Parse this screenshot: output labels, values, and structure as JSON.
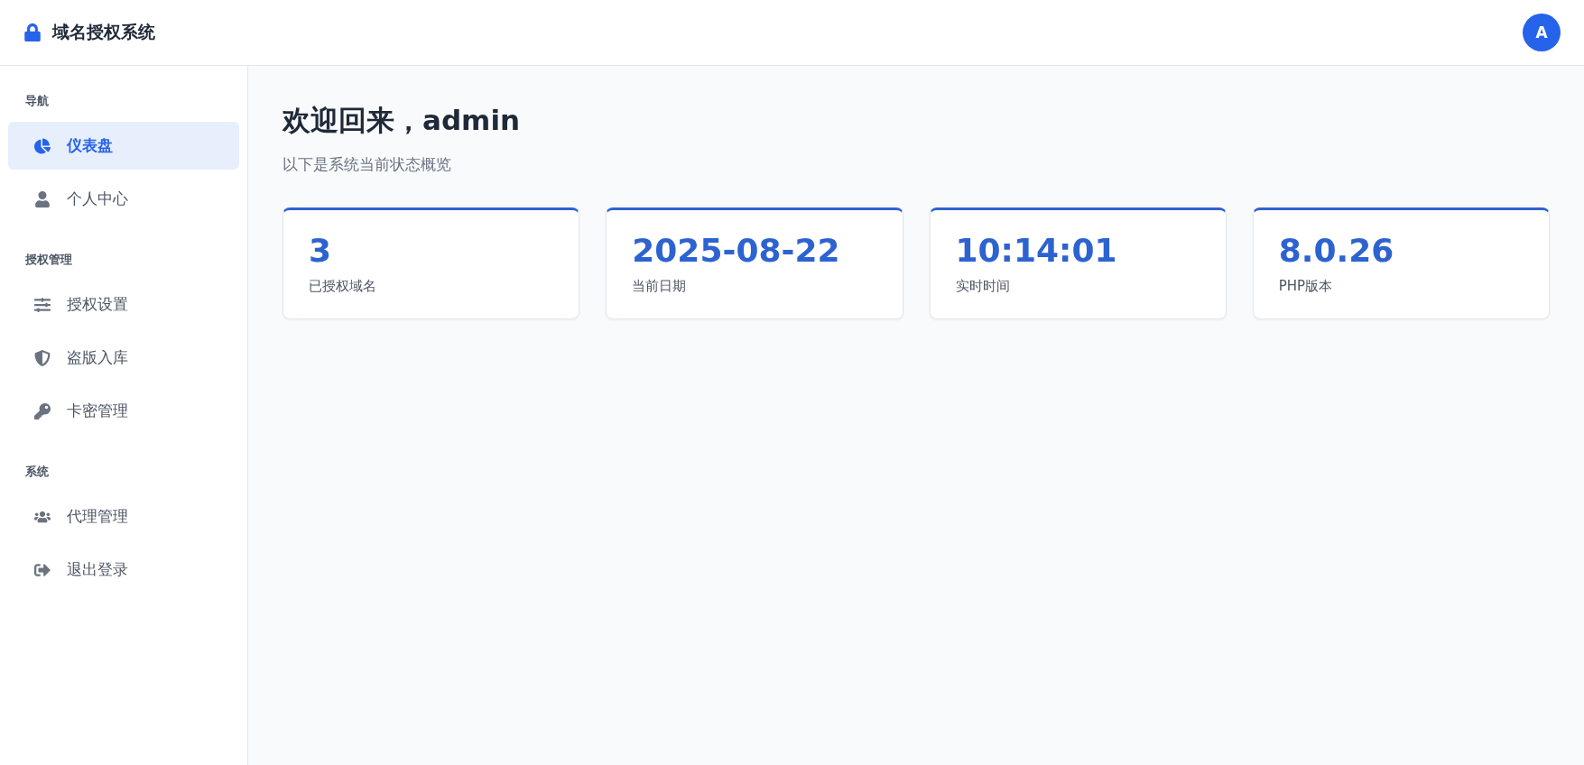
{
  "header": {
    "title": "域名授权系统",
    "avatar": "A"
  },
  "sidebar": {
    "sections": [
      {
        "heading": "导航",
        "items": [
          {
            "label": "仪表盘",
            "kind": "chart",
            "selected": true
          },
          {
            "label": "个人中心",
            "kind": "user",
            "selected": false
          }
        ]
      },
      {
        "heading": "授权管理",
        "items": [
          {
            "label": "授权设置",
            "kind": "sliders",
            "selected": false
          },
          {
            "label": "盗版入库",
            "kind": "shield",
            "selected": false
          },
          {
            "label": "卡密管理",
            "kind": "key",
            "selected": false
          }
        ]
      },
      {
        "heading": "系统",
        "items": [
          {
            "label": "代理管理",
            "kind": "users",
            "selected": false
          },
          {
            "label": "退出登录",
            "kind": "logout",
            "selected": false
          }
        ]
      }
    ]
  },
  "main": {
    "title": "欢迎回来，admin",
    "subtitle": "以下是系统当前状态概览",
    "stats": [
      {
        "value": "3",
        "label": "已授权域名"
      },
      {
        "value": "2025-08-22",
        "label": "当前日期"
      },
      {
        "value": "10:14:01",
        "label": "实时时间"
      },
      {
        "value": "8.0.26",
        "label": "PHP版本"
      }
    ]
  }
}
